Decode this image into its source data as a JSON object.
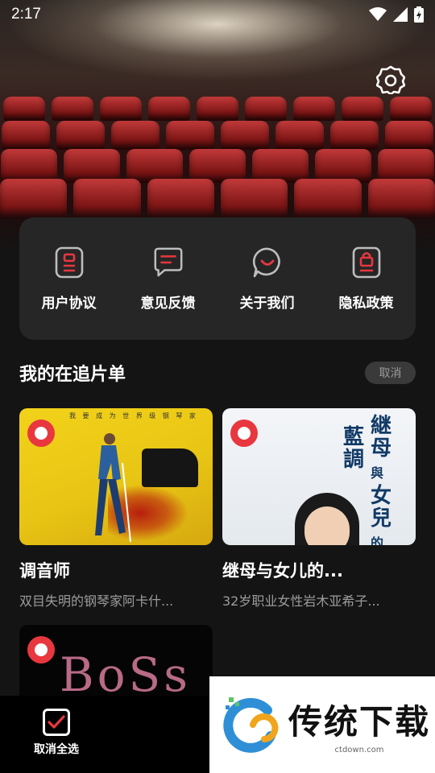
{
  "status_bar": {
    "time": "2:17",
    "icons": [
      "wifi-icon",
      "signal-icon",
      "battery-charging-icon"
    ]
  },
  "header": {
    "settings_icon": "gear-icon"
  },
  "menu": {
    "items": [
      {
        "label": "用户协议",
        "icon": "user-agreement-icon"
      },
      {
        "label": "意见反馈",
        "icon": "feedback-message-icon"
      },
      {
        "label": "关于我们",
        "icon": "about-smile-icon"
      },
      {
        "label": "隐私政策",
        "icon": "privacy-lock-icon"
      }
    ]
  },
  "watchlist": {
    "title": "我的在追片单",
    "cancel_label": "取消",
    "items": [
      {
        "title": "调音师",
        "desc": "双目失明的钢琴家阿卡什...",
        "poster_text": "我 要 成 为 世 界 级 钢 琴 家",
        "selected": true
      },
      {
        "title": "继母与女儿的...",
        "desc": "32岁职业女性岩木亚希子...",
        "poster_text": [
          "継母",
          "與",
          "女兒",
          "的",
          "藍調"
        ],
        "selected": true
      },
      {
        "title": "",
        "desc": "",
        "poster_text": "BoSs",
        "selected": true
      }
    ]
  },
  "bottom_bar": {
    "action_label": "取消全选"
  },
  "watermark": {
    "brand": "传统下载",
    "url": "ctdown.com"
  },
  "colors": {
    "accent": "#e8373f",
    "background": "#141414",
    "card": "#262626"
  }
}
